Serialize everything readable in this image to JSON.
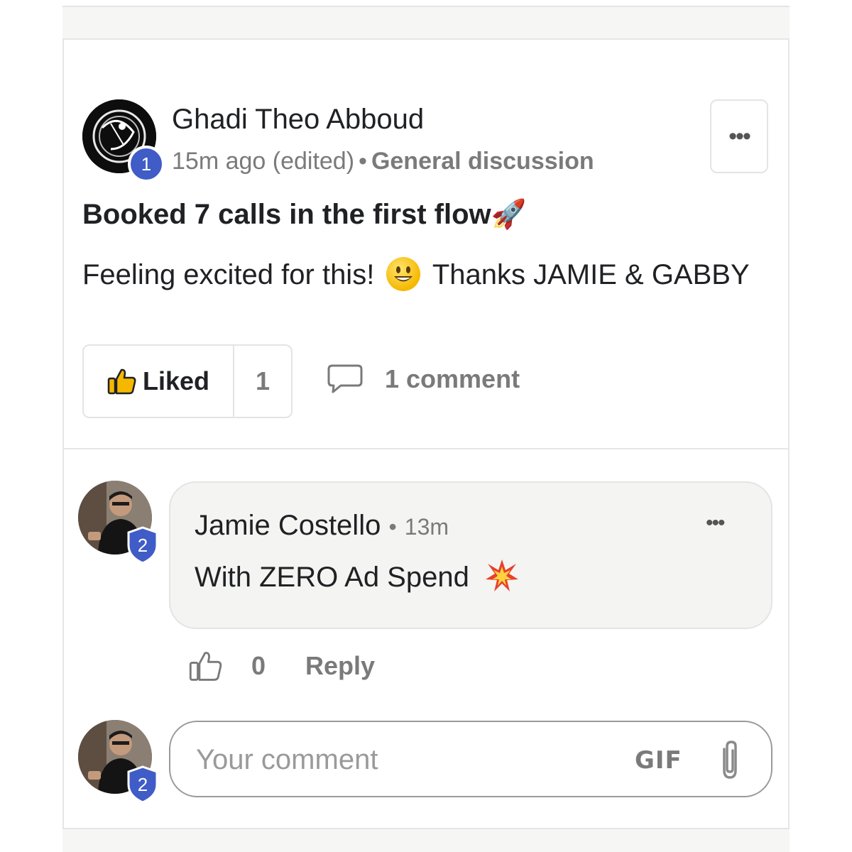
{
  "post": {
    "author": "Ghadi Theo Abboud",
    "author_level": "1",
    "time": "15m ago (edited)",
    "separator": "•",
    "category": "General discussion",
    "more_label": "•••",
    "title": "Booked 7 calls in the first flow",
    "title_emoji": "🚀",
    "body_before": "Feeling excited for this!",
    "body_after": "Thanks JAMIE & GABBY",
    "like_label": "Liked",
    "like_count": "1",
    "comment_count_label": "1 comment"
  },
  "comment": {
    "author": "Jamie Costello",
    "author_level": "2",
    "separator": "•",
    "time": "13m",
    "more_label": "•••",
    "text": "With ZERO Ad Spend",
    "like_count": "0",
    "reply_label": "Reply"
  },
  "composer": {
    "avatar_level": "2",
    "placeholder": "Your comment",
    "gif_label": "GIF"
  },
  "colors": {
    "level_badge": "#3f5cc7",
    "like_icon": "#f5b800",
    "muted_text": "#7a7a7a"
  },
  "icons": [
    "thumbs-up-icon",
    "comment-bubble-icon",
    "paperclip-icon",
    "more-icon"
  ]
}
